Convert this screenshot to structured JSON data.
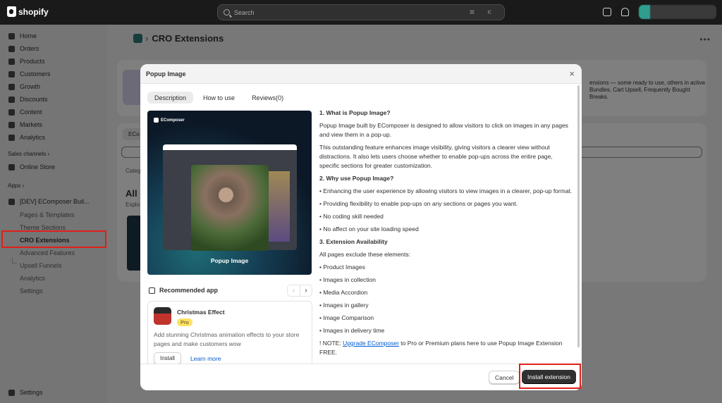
{
  "topbar": {
    "brand": "shopify",
    "search_placeholder": "Search",
    "shortcut": "⌘ K"
  },
  "sidebar": {
    "items": [
      {
        "label": "Home",
        "icon": "home-icon"
      },
      {
        "label": "Orders",
        "icon": "orders-icon"
      },
      {
        "label": "Products",
        "icon": "products-icon"
      },
      {
        "label": "Customers",
        "icon": "customers-icon"
      },
      {
        "label": "Growth",
        "icon": "growth-icon"
      },
      {
        "label": "Discounts",
        "icon": "discounts-icon"
      },
      {
        "label": "Content",
        "icon": "content-icon"
      },
      {
        "label": "Markets",
        "icon": "markets-icon"
      },
      {
        "label": "Analytics",
        "icon": "analytics-icon"
      }
    ],
    "sales_channels_label": "Sales channels ›",
    "online_store": "Online Store",
    "apps_label": "Apps ›",
    "app_name": "[DEV] EComposer Buil...",
    "app_sub_items": [
      "Pages & Templates",
      "Theme Sections",
      "CRO Extensions",
      "Advanced Features",
      "Upsell Funnels",
      "Analytics",
      "Settings"
    ],
    "settings": "Settings"
  },
  "main": {
    "title": "CRO Extensions",
    "bg_text": "ensions — some ready to use, others in active",
    "bg_text2": "Bundles, Cart Upsell, Frequently Bought",
    "bg_text3": "Breaks.",
    "bg_tab": "ECo",
    "bg_filter": "Categ",
    "bg_heading": "All e",
    "bg_explore": "Explo"
  },
  "modal": {
    "title": "Popup Image",
    "tabs": [
      "Description",
      "How to use",
      "Reviews(0)"
    ],
    "hero_brand": "EComposer",
    "hero_label": "Popup Image",
    "recommended_title": "Recommended app",
    "rec_app": {
      "name": "Christmas Effect",
      "badge": "Pro",
      "description": "Add stunning Christmas animation effects to your store pages and make customers wow",
      "install": "Install",
      "learn_more": "Learn more"
    },
    "content": {
      "h1": "1. What is Popup Image?",
      "p1": "Popup Image built by EComposer is designed to allow visitors to click on images in any pages and view them in a pop-up.",
      "p2": "This outstanding feature enhances image visibility, giving visitors a clearer view without distractions. It also lets users choose whether to enable pop-ups across the entire page, specific sections for greater customization.",
      "h2": "2. Why use Popup Image?",
      "b1": "• Enhancing the user experience by allowing visitors to view images in a clearer, pop-up format.",
      "b2": "• Providing flexibility to enable pop-ups on any sections or pages you want.",
      "b3": "• No coding skill needed",
      "b4": "• No affect on your site loading speed",
      "h3": "3. Extension Availability",
      "p3": "All pages exclude these elements:",
      "e1": "• Product Images",
      "e2": "• Images in collection",
      "e3": "• Media Accordion",
      "e4": "• Images in gallery",
      "e5": "• Image Comparison",
      "e6": "• Images in delivery time",
      "note_prefix": "! NOTE: ",
      "note_link": "Upgrade EComposer",
      "note_suffix": " to Pro or Premium plans here to use Popup Image Extension FREE."
    },
    "cancel": "Cancel",
    "install_extension": "Install extension"
  }
}
